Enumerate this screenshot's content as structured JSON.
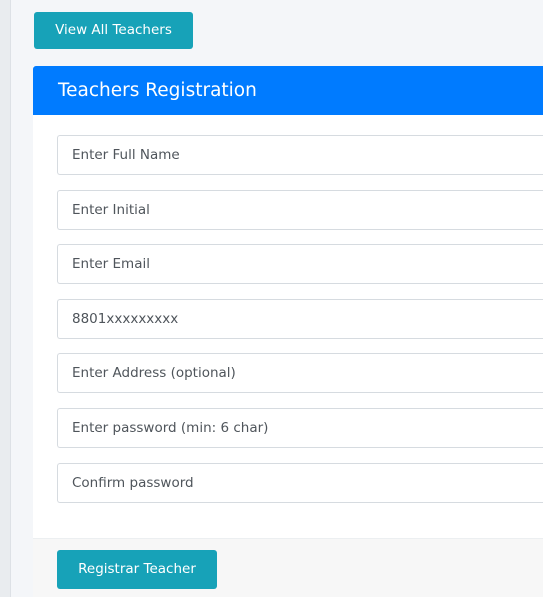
{
  "toolbar": {
    "view_all_label": "View All Teachers"
  },
  "registration_form": {
    "title": "Teachers Registration",
    "fields": [
      {
        "placeholder": "Enter Full Name",
        "value": ""
      },
      {
        "placeholder": "Enter Initial",
        "value": ""
      },
      {
        "placeholder": "Enter Email",
        "value": ""
      },
      {
        "placeholder": "8801xxxxxxxxx",
        "value": ""
      },
      {
        "placeholder": "Enter Address (optional)",
        "value": ""
      },
      {
        "placeholder": "Enter password (min: 6 char)",
        "value": ""
      },
      {
        "placeholder": "Confirm password",
        "value": ""
      }
    ],
    "submit_label": "Registrar Teacher"
  },
  "colors": {
    "primary": "#007bff",
    "info": "#17a2b8",
    "page_background": "#f4f6f9",
    "footer_background": "#f7f7f7"
  }
}
